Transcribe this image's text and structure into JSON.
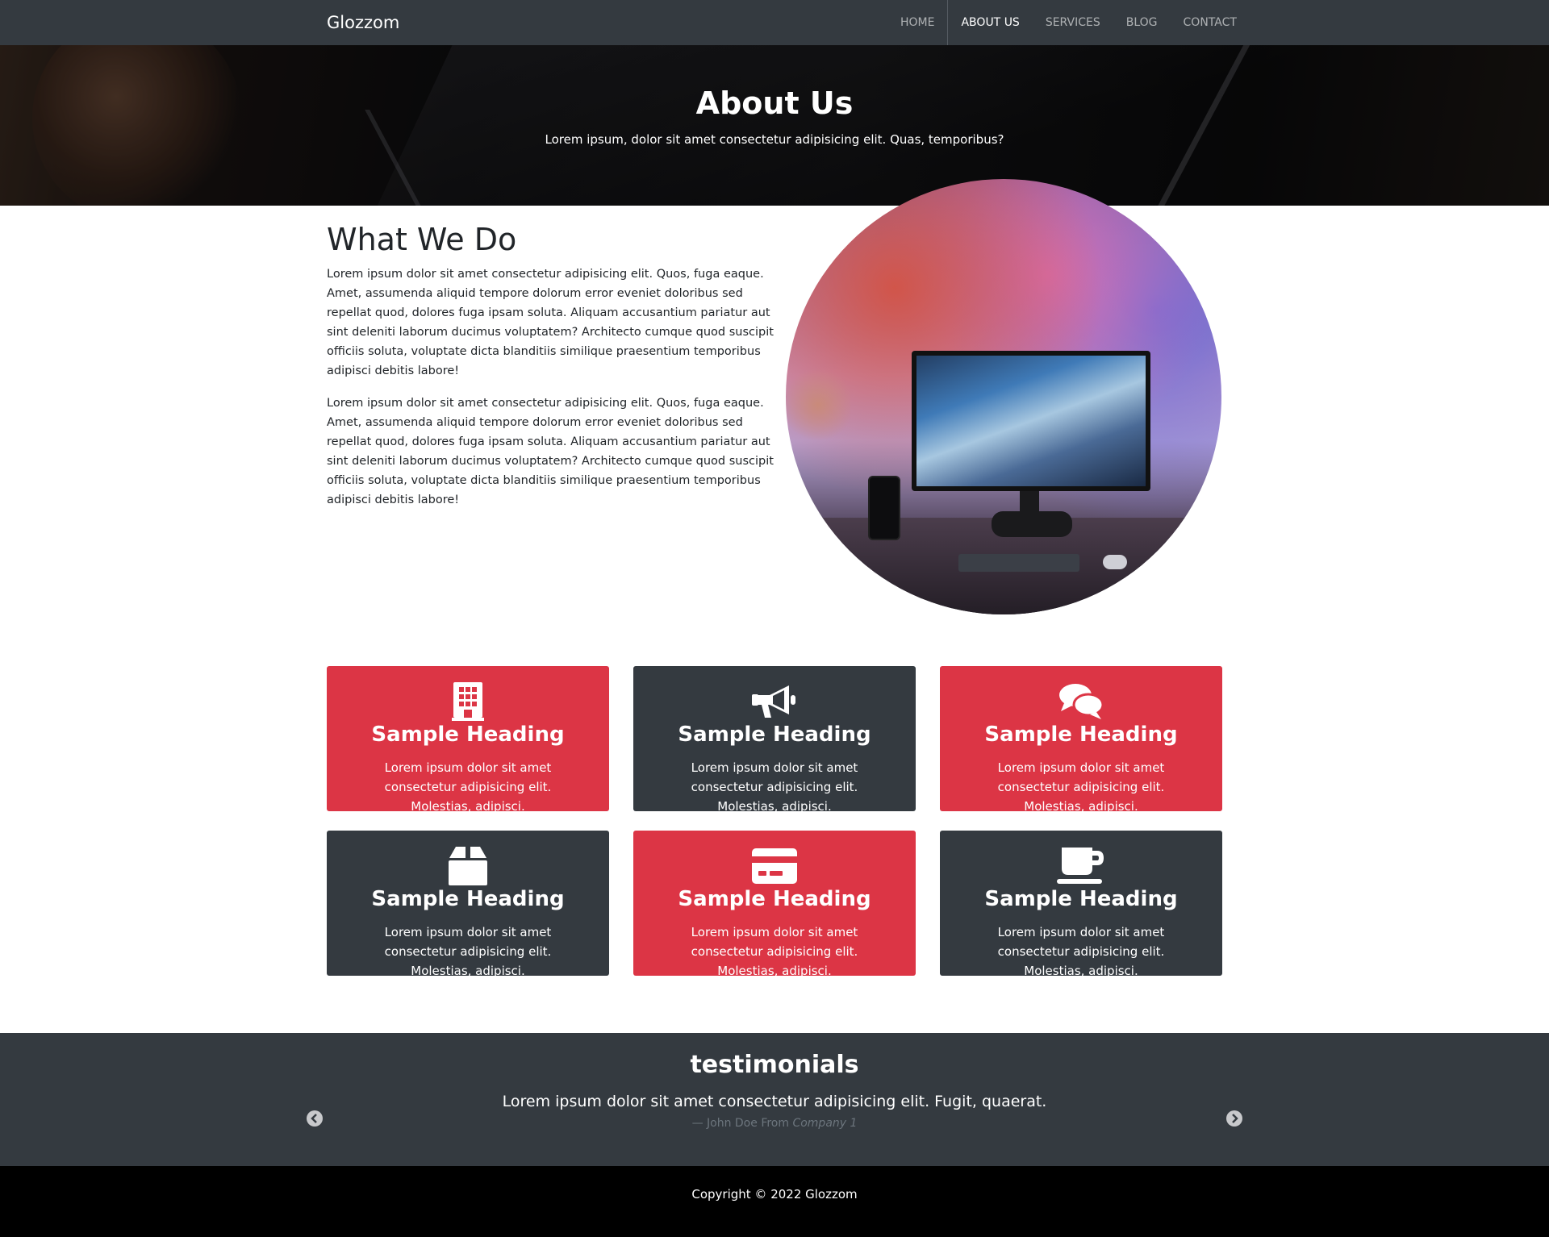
{
  "navbar": {
    "brand": "Glozzom",
    "links": [
      {
        "label": "HOME"
      },
      {
        "label": "ABOUT US"
      },
      {
        "label": "SERVICES"
      },
      {
        "label": "BLOG"
      },
      {
        "label": "CONTACT"
      }
    ]
  },
  "hero": {
    "title": "About Us",
    "subtitle": "Lorem ipsum, dolor sit amet consectetur adipisicing elit. Quas, temporibus?"
  },
  "what_we_do": {
    "title": "What We Do",
    "paragraphs": [
      "Lorem ipsum dolor sit amet consectetur adipisicing elit. Quos, fuga eaque. Amet, assumenda aliquid tempore dolorum error eveniet doloribus sed repellat quod, dolores fuga ipsam soluta. Aliquam accusantium pariatur aut sint deleniti laborum ducimus voluptatem? Architecto cumque quod suscipit officiis soluta, voluptate dicta blanditiis similique praesentium temporibus adipisci debitis labore!",
      "Lorem ipsum dolor sit amet consectetur adipisicing elit. Quos, fuga eaque. Amet, assumenda aliquid tempore dolorum error eveniet doloribus sed repellat quod, dolores fuga ipsam soluta. Aliquam accusantium pariatur aut sint deleniti laborum ducimus voluptatem? Architecto cumque quod suscipit officiis soluta, voluptate dicta blanditiis similique praesentium temporibus adipisci debitis labore!"
    ]
  },
  "cards": [
    {
      "icon": "building-icon",
      "heading": "Sample Heading",
      "text": "Lorem ipsum dolor sit amet consectetur adipisicing elit. Molestias, adipisci.",
      "color": "#dc3545"
    },
    {
      "icon": "megaphone-icon",
      "heading": "Sample Heading",
      "text": "Lorem ipsum dolor sit amet consectetur adipisicing elit. Molestias, adipisci.",
      "color": "#343a40"
    },
    {
      "icon": "comments-icon",
      "heading": "Sample Heading",
      "text": "Lorem ipsum dolor sit amet consectetur adipisicing elit. Molestias, adipisci.",
      "color": "#dc3545"
    },
    {
      "icon": "box-icon",
      "heading": "Sample Heading",
      "text": "Lorem ipsum dolor sit amet consectetur adipisicing elit. Molestias, adipisci.",
      "color": "#343a40"
    },
    {
      "icon": "credit-card-icon",
      "heading": "Sample Heading",
      "text": "Lorem ipsum dolor sit amet consectetur adipisicing elit. Molestias, adipisci.",
      "color": "#dc3545"
    },
    {
      "icon": "coffee-icon",
      "heading": "Sample Heading",
      "text": "Lorem ipsum dolor sit amet consectetur adipisicing elit. Molestias, adipisci.",
      "color": "#343a40"
    }
  ],
  "testimonials": {
    "title": "testimonials",
    "quote": "Lorem ipsum dolor sit amet consectetur adipisicing elit. Fugit, quaerat.",
    "author_prefix": "— John Doe From",
    "company": "Company 1",
    "prev_icon": "chevron-left-icon",
    "next_icon": "chevron-right-icon"
  },
  "footer": {
    "copyright": "Copyright © 2022 Glozzom"
  }
}
